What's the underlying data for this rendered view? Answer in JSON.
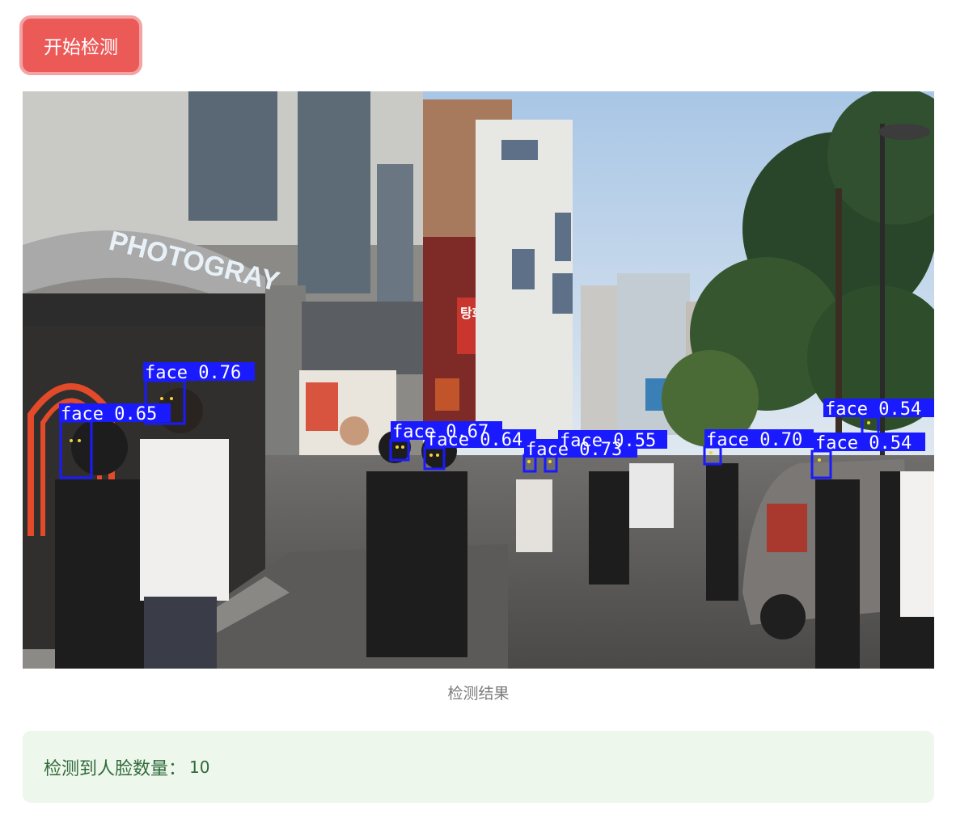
{
  "start_button": {
    "label": "开始检测"
  },
  "result": {
    "caption": "检测结果",
    "detections": [
      {
        "label": "face 0.76"
      },
      {
        "label": "face 0.65"
      },
      {
        "label": "face 0.67"
      },
      {
        "label": "face 0.64"
      },
      {
        "label": "face 0.55"
      },
      {
        "label": "face 0.73"
      },
      {
        "label": "face 0.70"
      },
      {
        "label": "face 0.54"
      },
      {
        "label": "face 0.54"
      }
    ],
    "signs": {
      "photography": "PHOTOGRAY",
      "korean_sign": "탕화 쿵푸"
    }
  },
  "summary": {
    "label": "检测到人脸数量：",
    "count": "10"
  },
  "colors": {
    "button_bg": "#ec5a58",
    "button_border": "#f2a3a3",
    "detection_box": "#1a1aff",
    "panel_bg": "#eef7ec",
    "panel_text": "#2f6a3a"
  }
}
